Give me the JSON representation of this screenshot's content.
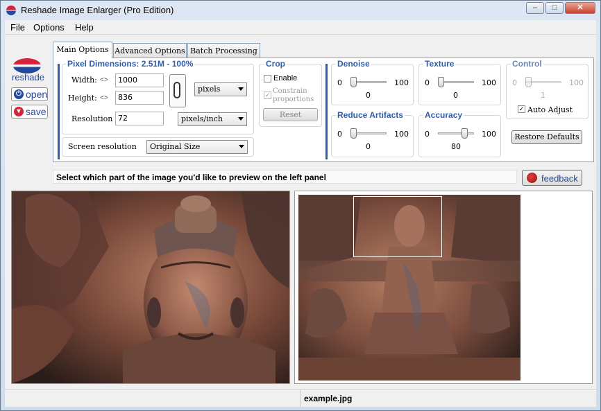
{
  "window": {
    "title": "Reshade Image Enlarger (Pro Edition)",
    "minimize": "–",
    "maximize": "□",
    "close": "✕"
  },
  "menu": {
    "file": "File",
    "options": "Options",
    "help": "Help"
  },
  "sidebar": {
    "logo_text": "reshade",
    "open_label": "open",
    "save_label": "save"
  },
  "tabs": [
    {
      "label": "Main Options",
      "active": true
    },
    {
      "label": "Advanced Options",
      "active": false
    },
    {
      "label": "Batch Processing",
      "active": false
    }
  ],
  "pixel_dimensions": {
    "title": "Pixel Dimensions:  2.51M - 100%",
    "width_label": "Width:",
    "width_value": "1000",
    "height_label": "Height:",
    "height_value": "836",
    "unit": "pixels",
    "resolution_label": "Resolution",
    "resolution_value": "72",
    "resolution_unit": "pixels/inch",
    "screen_resolution_label": "Screen resolution",
    "screen_resolution_value": "Original Size"
  },
  "crop": {
    "title": "Crop",
    "enable_label": "Enable",
    "enable_checked": false,
    "constrain_label_1": "Constrain",
    "constrain_label_2": "proportions",
    "constrain_checked": true,
    "reset_label": "Reset"
  },
  "sliders": {
    "denoise": {
      "title": "Denoise",
      "min": "0",
      "max": "100",
      "value": "0",
      "fraction": 0.0
    },
    "texture": {
      "title": "Texture",
      "min": "0",
      "max": "100",
      "value": "0",
      "fraction": 0.0
    },
    "control": {
      "title": "Control",
      "min": "0",
      "max": "100",
      "value": "1",
      "fraction": 0.01
    },
    "reduce_artifacts": {
      "title": "Reduce Artifacts",
      "min": "0",
      "max": "100",
      "value": "0",
      "fraction": 0.0
    },
    "accuracy": {
      "title": "Accuracy",
      "min": "0",
      "max": "100",
      "value": "80",
      "fraction": 0.8
    }
  },
  "control": {
    "auto_adjust_label": "Auto Adjust",
    "auto_adjust_checked": true,
    "restore_defaults_label": "Restore Defaults"
  },
  "info": {
    "text": "Select which part of the image you'd like to preview on the left panel",
    "feedback_label": "feedback"
  },
  "status": {
    "filename": "example.jpg"
  },
  "colors": {
    "accent": "#2f5da8",
    "brand_red": "#d4233a",
    "brand_blue": "#24489b"
  }
}
